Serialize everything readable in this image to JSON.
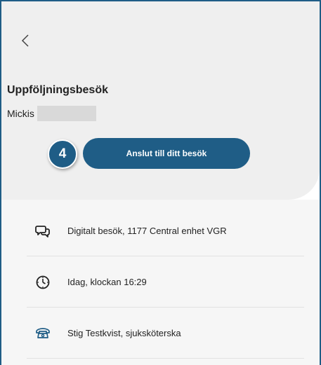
{
  "header": {
    "title": "Uppföljningsbesök",
    "patient_name": "Mickis"
  },
  "step_badge": "4",
  "cta_label": "Anslut till ditt besök",
  "details": [
    {
      "icon": "chat-bubbles-icon",
      "text": "Digitalt besök, 1177 Central enhet VGR"
    },
    {
      "icon": "clock-icon",
      "text": "Idag, klockan 16:29"
    },
    {
      "icon": "telephone-icon",
      "text": "Stig Testkvist, sjuksköterska"
    }
  ],
  "colors": {
    "primary": "#1f5d86",
    "header_bg": "#efefef",
    "body_bg": "#f6f6f6"
  }
}
